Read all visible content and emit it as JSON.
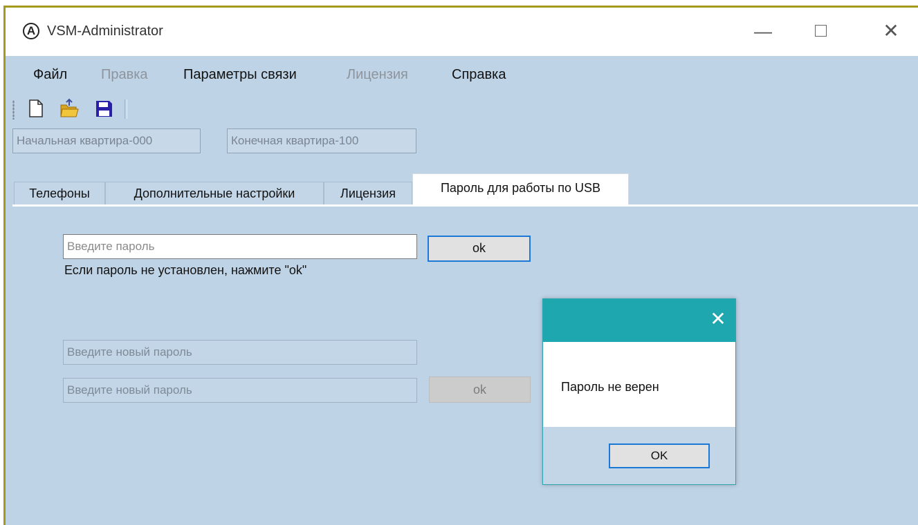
{
  "window": {
    "app_icon_glyph": "A",
    "title": "VSM-Administrator",
    "minimize_glyph": "—",
    "close_glyph": "✕"
  },
  "menu": {
    "file": "Файл",
    "edit": "Правка",
    "connection": "Параметры связи",
    "license": "Лицензия",
    "help": "Справка"
  },
  "toolbar": {
    "icons": [
      "new-file-icon",
      "open-folder-icon",
      "save-icon"
    ]
  },
  "range": {
    "start": "Начальная квартира-000",
    "end": "Конечная квартира-100"
  },
  "tabs": [
    {
      "label": "Телефоны"
    },
    {
      "label": "Дополнительные настройки"
    },
    {
      "label": "Лицензия"
    },
    {
      "label": "Пароль для работы по USB",
      "active": true
    }
  ],
  "password_tab": {
    "password_placeholder": "Введите пароль",
    "ok_label": "ok",
    "hint": "Если пароль не установлен, нажмите \"ok\"",
    "new_password_placeholder_1": "Введите новый пароль",
    "new_password_placeholder_2": "Введите новый пароль",
    "new_ok_label": "ok"
  },
  "dialog": {
    "close_glyph": "✕",
    "message": "Пароль не верен",
    "ok_label": "OK"
  },
  "colors": {
    "window_bg": "#bfd3e6",
    "window_border": "#a59a1e",
    "dialog_title_bg": "#1ea7ae",
    "focus_border": "#1b78d6"
  }
}
